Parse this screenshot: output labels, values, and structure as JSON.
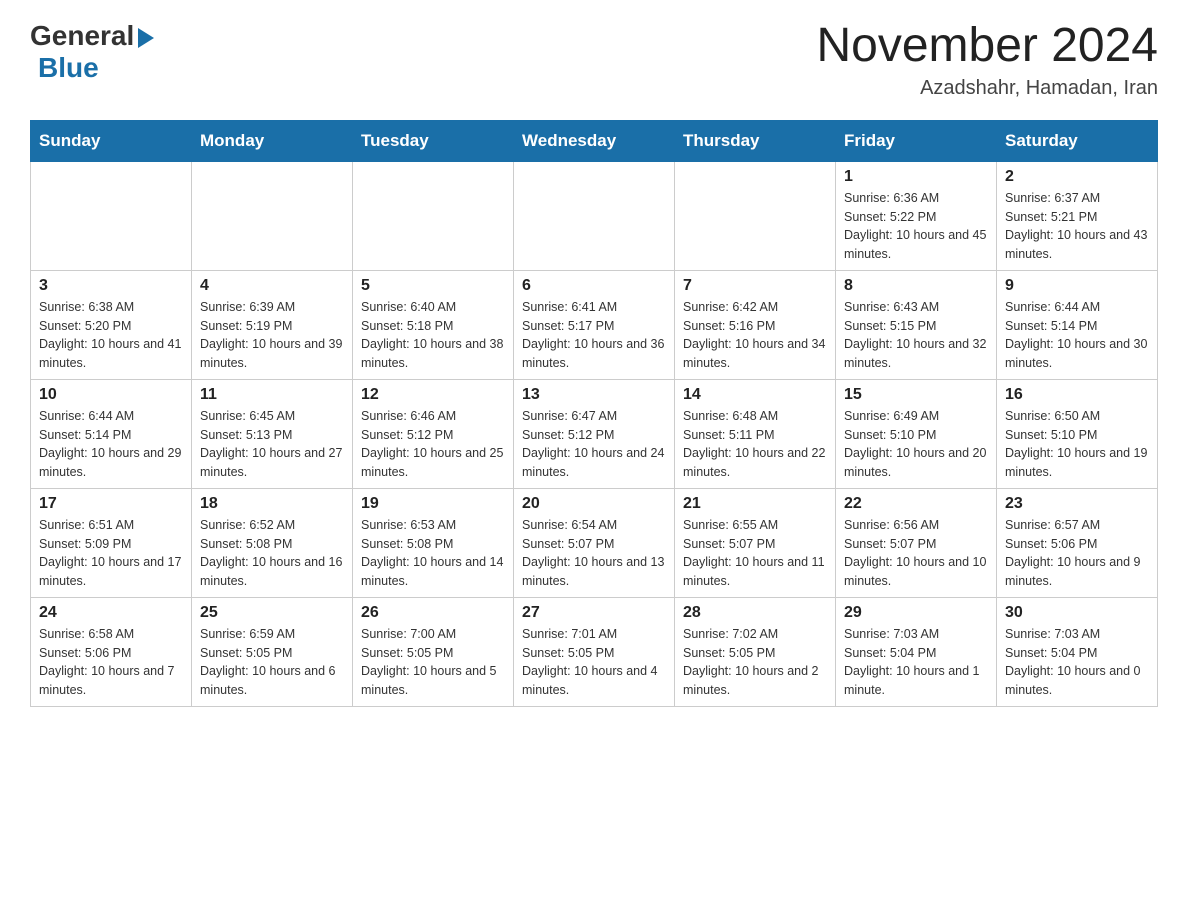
{
  "header": {
    "logo": {
      "general": "General",
      "blue": "Blue",
      "arrow_label": "logo-arrow"
    },
    "title": "November 2024",
    "subtitle": "Azadshahr, Hamadan, Iran"
  },
  "calendar": {
    "days_of_week": [
      "Sunday",
      "Monday",
      "Tuesday",
      "Wednesday",
      "Thursday",
      "Friday",
      "Saturday"
    ],
    "weeks": [
      [
        {
          "day": "",
          "info": ""
        },
        {
          "day": "",
          "info": ""
        },
        {
          "day": "",
          "info": ""
        },
        {
          "day": "",
          "info": ""
        },
        {
          "day": "",
          "info": ""
        },
        {
          "day": "1",
          "info": "Sunrise: 6:36 AM\nSunset: 5:22 PM\nDaylight: 10 hours and 45 minutes."
        },
        {
          "day": "2",
          "info": "Sunrise: 6:37 AM\nSunset: 5:21 PM\nDaylight: 10 hours and 43 minutes."
        }
      ],
      [
        {
          "day": "3",
          "info": "Sunrise: 6:38 AM\nSunset: 5:20 PM\nDaylight: 10 hours and 41 minutes."
        },
        {
          "day": "4",
          "info": "Sunrise: 6:39 AM\nSunset: 5:19 PM\nDaylight: 10 hours and 39 minutes."
        },
        {
          "day": "5",
          "info": "Sunrise: 6:40 AM\nSunset: 5:18 PM\nDaylight: 10 hours and 38 minutes."
        },
        {
          "day": "6",
          "info": "Sunrise: 6:41 AM\nSunset: 5:17 PM\nDaylight: 10 hours and 36 minutes."
        },
        {
          "day": "7",
          "info": "Sunrise: 6:42 AM\nSunset: 5:16 PM\nDaylight: 10 hours and 34 minutes."
        },
        {
          "day": "8",
          "info": "Sunrise: 6:43 AM\nSunset: 5:15 PM\nDaylight: 10 hours and 32 minutes."
        },
        {
          "day": "9",
          "info": "Sunrise: 6:44 AM\nSunset: 5:14 PM\nDaylight: 10 hours and 30 minutes."
        }
      ],
      [
        {
          "day": "10",
          "info": "Sunrise: 6:44 AM\nSunset: 5:14 PM\nDaylight: 10 hours and 29 minutes."
        },
        {
          "day": "11",
          "info": "Sunrise: 6:45 AM\nSunset: 5:13 PM\nDaylight: 10 hours and 27 minutes."
        },
        {
          "day": "12",
          "info": "Sunrise: 6:46 AM\nSunset: 5:12 PM\nDaylight: 10 hours and 25 minutes."
        },
        {
          "day": "13",
          "info": "Sunrise: 6:47 AM\nSunset: 5:12 PM\nDaylight: 10 hours and 24 minutes."
        },
        {
          "day": "14",
          "info": "Sunrise: 6:48 AM\nSunset: 5:11 PM\nDaylight: 10 hours and 22 minutes."
        },
        {
          "day": "15",
          "info": "Sunrise: 6:49 AM\nSunset: 5:10 PM\nDaylight: 10 hours and 20 minutes."
        },
        {
          "day": "16",
          "info": "Sunrise: 6:50 AM\nSunset: 5:10 PM\nDaylight: 10 hours and 19 minutes."
        }
      ],
      [
        {
          "day": "17",
          "info": "Sunrise: 6:51 AM\nSunset: 5:09 PM\nDaylight: 10 hours and 17 minutes."
        },
        {
          "day": "18",
          "info": "Sunrise: 6:52 AM\nSunset: 5:08 PM\nDaylight: 10 hours and 16 minutes."
        },
        {
          "day": "19",
          "info": "Sunrise: 6:53 AM\nSunset: 5:08 PM\nDaylight: 10 hours and 14 minutes."
        },
        {
          "day": "20",
          "info": "Sunrise: 6:54 AM\nSunset: 5:07 PM\nDaylight: 10 hours and 13 minutes."
        },
        {
          "day": "21",
          "info": "Sunrise: 6:55 AM\nSunset: 5:07 PM\nDaylight: 10 hours and 11 minutes."
        },
        {
          "day": "22",
          "info": "Sunrise: 6:56 AM\nSunset: 5:07 PM\nDaylight: 10 hours and 10 minutes."
        },
        {
          "day": "23",
          "info": "Sunrise: 6:57 AM\nSunset: 5:06 PM\nDaylight: 10 hours and 9 minutes."
        }
      ],
      [
        {
          "day": "24",
          "info": "Sunrise: 6:58 AM\nSunset: 5:06 PM\nDaylight: 10 hours and 7 minutes."
        },
        {
          "day": "25",
          "info": "Sunrise: 6:59 AM\nSunset: 5:05 PM\nDaylight: 10 hours and 6 minutes."
        },
        {
          "day": "26",
          "info": "Sunrise: 7:00 AM\nSunset: 5:05 PM\nDaylight: 10 hours and 5 minutes."
        },
        {
          "day": "27",
          "info": "Sunrise: 7:01 AM\nSunset: 5:05 PM\nDaylight: 10 hours and 4 minutes."
        },
        {
          "day": "28",
          "info": "Sunrise: 7:02 AM\nSunset: 5:05 PM\nDaylight: 10 hours and 2 minutes."
        },
        {
          "day": "29",
          "info": "Sunrise: 7:03 AM\nSunset: 5:04 PM\nDaylight: 10 hours and 1 minute."
        },
        {
          "day": "30",
          "info": "Sunrise: 7:03 AM\nSunset: 5:04 PM\nDaylight: 10 hours and 0 minutes."
        }
      ]
    ]
  }
}
